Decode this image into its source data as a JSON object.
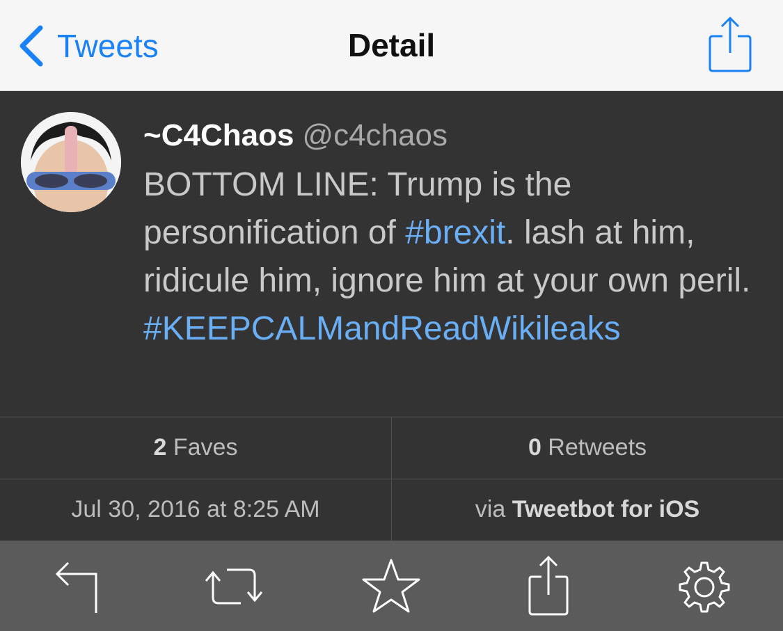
{
  "nav": {
    "back_label": "Tweets",
    "title": "Detail",
    "accent": "#1a82f7"
  },
  "tweet": {
    "author_name": "~C4Chaos",
    "author_handle": "@c4chaos",
    "text_parts": [
      "BOTTOM LINE: Trump is the personification of ",
      "#brexit",
      ". lash at him, ridicule him, ignore him at your own peril. ",
      "#KEEPCALMandReadWikileaks"
    ],
    "hashtag_color": "#6aaef5"
  },
  "stats": {
    "faves_count": "2",
    "faves_label": " Faves",
    "retweets_count": "0",
    "retweets_label": " Retweets",
    "timestamp": "Jul 30, 2016 at 8:25 AM",
    "via_prefix": "via ",
    "client": "Tweetbot for iOS"
  },
  "toolbar": {
    "icons": [
      "reply-icon",
      "retweet-icon",
      "favorite-star-icon",
      "share-icon",
      "settings-gear-icon"
    ]
  }
}
